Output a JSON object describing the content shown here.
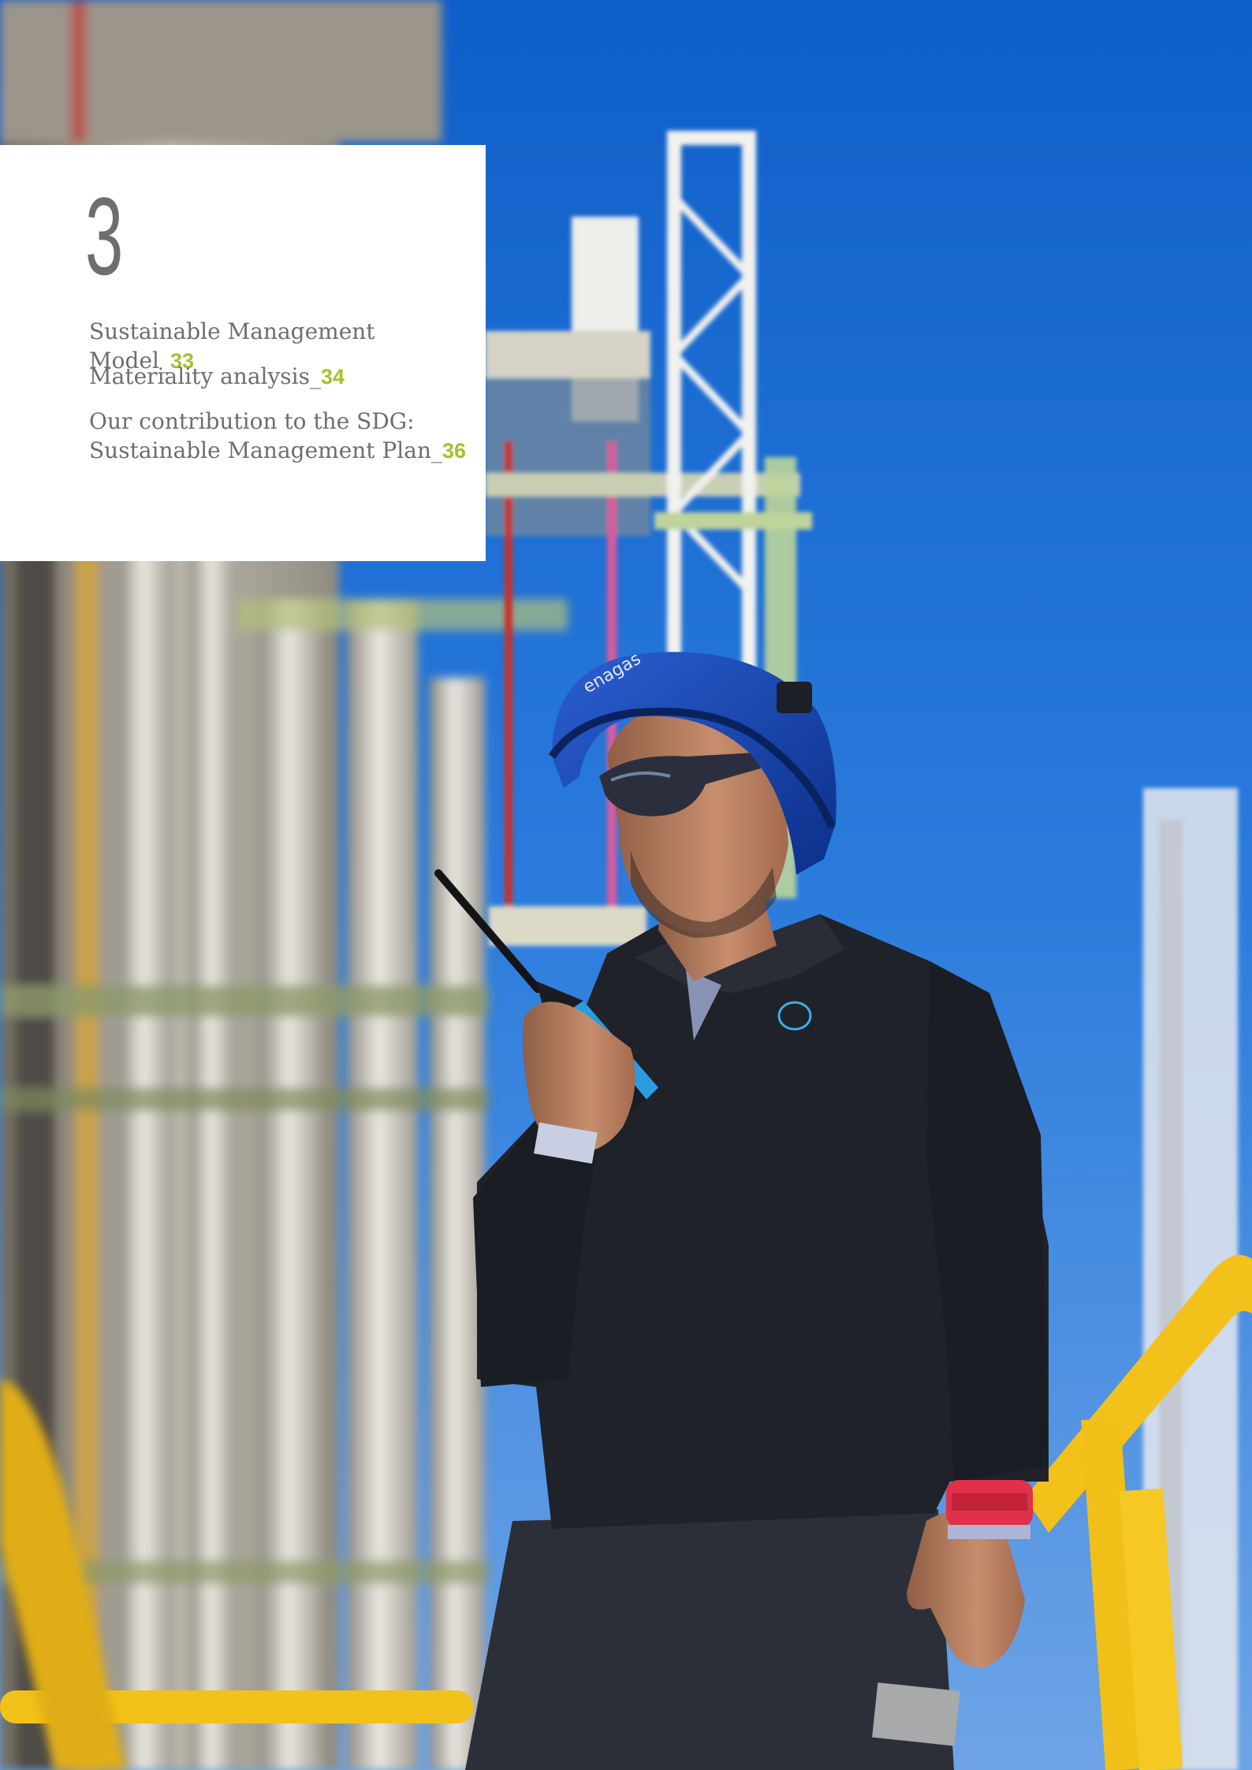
{
  "chapter": {
    "number": "3"
  },
  "toc": {
    "items": [
      {
        "title": "Sustainable Management Model_",
        "page": "33"
      },
      {
        "title": "Materiality analysis_",
        "page": "34"
      },
      {
        "title_line1": "Our contribution to the SDG:",
        "title_line2": "Sustainable Management Plan_",
        "page": "36"
      }
    ]
  },
  "photo": {
    "logo_text": "enagas"
  },
  "colors": {
    "accent_green": "#a3c22a",
    "text_gray": "#6d6e71",
    "sky_blue": "#1f6fd0",
    "rail_yellow": "#f2c21a"
  }
}
